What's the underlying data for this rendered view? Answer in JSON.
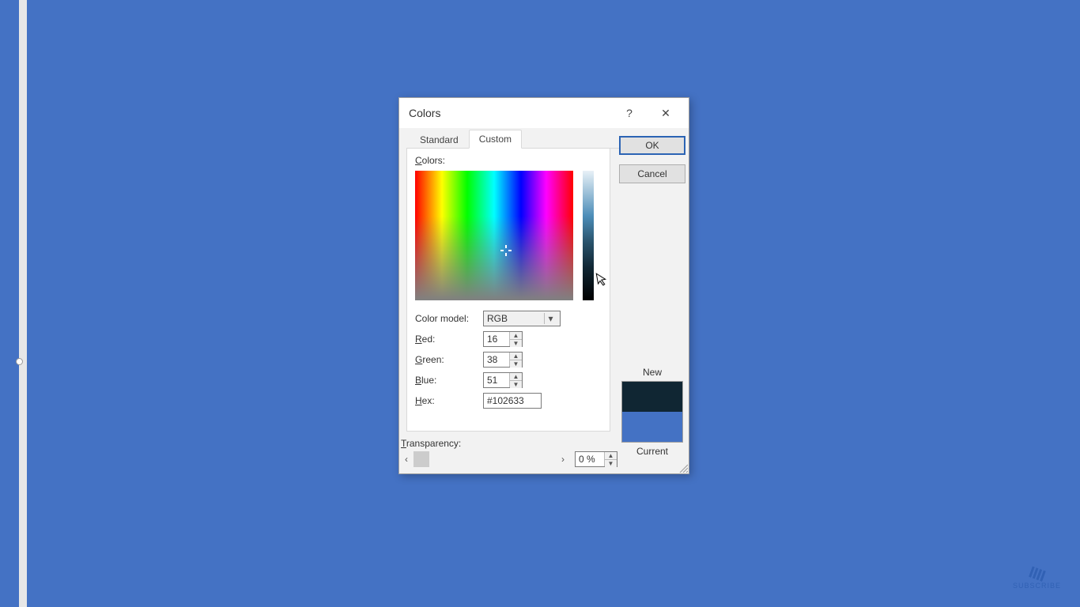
{
  "dialog": {
    "title": "Colors",
    "help": "?",
    "close": "✕",
    "tabs": {
      "standard": "Standard",
      "custom": "Custom"
    },
    "buttons": {
      "ok": "OK",
      "cancel": "Cancel"
    },
    "labels": {
      "colors": "Colors:",
      "colorModel": "Color model:",
      "red": "Red:",
      "green": "Green:",
      "blue": "Blue:",
      "hex": "Hex:",
      "transparency": "Transparency:",
      "new": "New",
      "current": "Current"
    },
    "values": {
      "colorModel": "RGB",
      "red": "16",
      "green": "38",
      "blue": "51",
      "hex": "#102633",
      "transparency": "0 %"
    },
    "colors": {
      "newColor": "#102633",
      "currentColor": "#4472C4"
    }
  },
  "watermark": "SUBSCRIBE"
}
